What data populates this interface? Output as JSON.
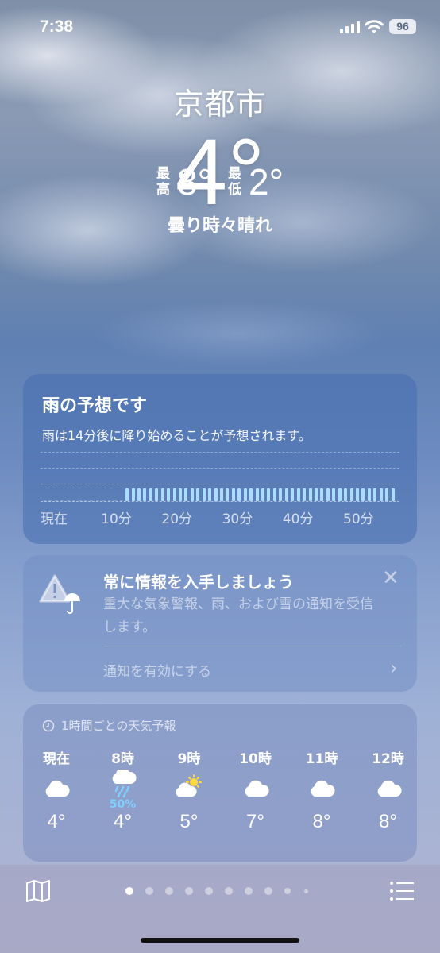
{
  "status_bar": {
    "time": "7:38",
    "battery": "96"
  },
  "location": {
    "city": "京都市",
    "temperature": "4°",
    "high_label": "最高",
    "high": "8°",
    "low_label": "最低",
    "low": "2°",
    "condition": "曇り時々晴れ"
  },
  "rain_card": {
    "title": "雨の予想です",
    "subtitle": "雨は14分後に降り始めることが予想されます。",
    "x_labels": [
      "現在",
      "10分",
      "20分",
      "30分",
      "40分",
      "50分"
    ]
  },
  "chart_data": {
    "type": "bar",
    "x": "minutes from now",
    "xlabels": [
      "現在",
      "10分",
      "20分",
      "30分",
      "40分",
      "50分"
    ],
    "rain_start_minute": 14,
    "rain_end_minute": 60,
    "intensity": 0.3
  },
  "alert_card": {
    "title": "常に情報を入手しましょう",
    "body": "重大な気象警報、雨、および雪の通知を受信します。",
    "link": "通知を有効にする"
  },
  "hourly": {
    "header": "1時間ごとの天気予報",
    "items": [
      {
        "label": "現在",
        "icon": "cloud-icon",
        "temp": "4°",
        "pct": ""
      },
      {
        "label": "8時",
        "icon": "cloud-rain-icon",
        "temp": "4°",
        "pct": "50%"
      },
      {
        "label": "9時",
        "icon": "partly-sunny-icon",
        "temp": "5°",
        "pct": ""
      },
      {
        "label": "10時",
        "icon": "cloud-icon",
        "temp": "7°",
        "pct": ""
      },
      {
        "label": "11時",
        "icon": "cloud-icon",
        "temp": "8°",
        "pct": ""
      },
      {
        "label": "12時",
        "icon": "cloud-icon",
        "temp": "8°",
        "pct": ""
      }
    ]
  },
  "page_dots": {
    "count": 10,
    "active_index": 0
  }
}
